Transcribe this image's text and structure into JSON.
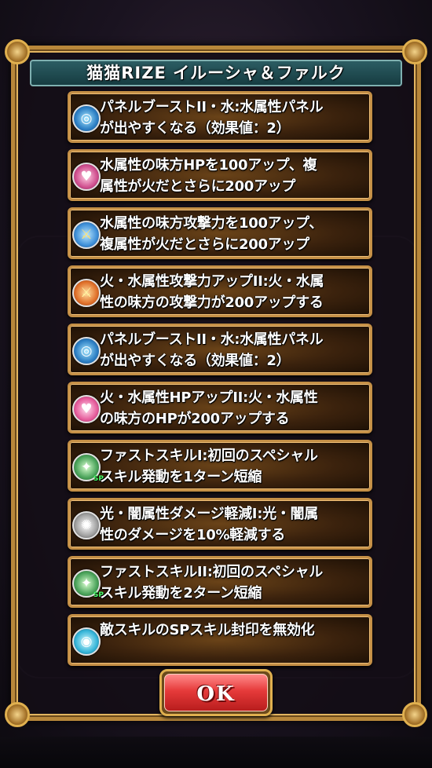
{
  "dialog": {
    "title": "猫猫RIZE イルーシャ＆ファルク",
    "ok_label": "OK"
  },
  "skills": [
    {
      "text": "パネルブーストII・水:水属性パネル\nが出やすくなる（効果値：2）",
      "icon": "water-panel-icon"
    },
    {
      "text": "水属性の味方HPを100アップ、複\n属性が火だとさらに200アップ",
      "icon": "hp-up-icon"
    },
    {
      "text": "水属性の味方攻撃力を100アップ、\n複属性が火だとさらに200アップ",
      "icon": "attack-up-icon"
    },
    {
      "text": "火・水属性攻撃力アップII:火・水属\n性の味方の攻撃力が200アップする",
      "icon": "fire-attack-up-icon"
    },
    {
      "text": "パネルブーストII・水:水属性パネル\nが出やすくなる（効果値：2）",
      "icon": "water-panel-icon"
    },
    {
      "text": "火・水属性HPアップII:火・水属性\nの味方のHPが200アップする",
      "icon": "hp-up-icon"
    },
    {
      "text": "ファストスキルI:初回のスペシャル\nスキル発動を1ターン短縮",
      "icon": "fast-skill-icon",
      "tag": "SP"
    },
    {
      "text": "光・闇属性ダメージ軽減I:光・闇属\n性のダメージを10%軽減する",
      "icon": "damage-reduce-icon"
    },
    {
      "text": "ファストスキルII:初回のスペシャル\nスキル発動を2ターン短縮",
      "icon": "fast-skill-icon",
      "tag": "SP"
    },
    {
      "text": "敵スキルのSPスキル封印を無効化",
      "icon": "seal-guard-icon"
    }
  ]
}
